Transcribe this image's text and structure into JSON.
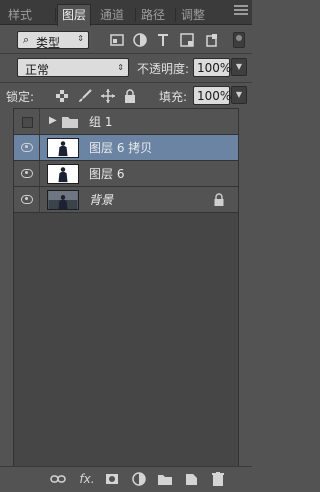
{
  "tabs": [
    {
      "label": "样式",
      "active": false
    },
    {
      "label": "图层",
      "active": true
    },
    {
      "label": "通道",
      "active": false
    },
    {
      "label": "路径",
      "active": false
    },
    {
      "label": "调整",
      "active": false
    }
  ],
  "filter": {
    "kind_label": "类型"
  },
  "blend": {
    "mode": "正常",
    "opacity_label": "不透明度:",
    "opacity_value": "100%"
  },
  "lock": {
    "label": "锁定:",
    "fill_label": "填充:",
    "fill_value": "100%"
  },
  "layers": [
    {
      "name": "组 1",
      "visible": false,
      "type": "group"
    },
    {
      "name": "图层 6 拷贝",
      "visible": true,
      "selected": true,
      "type": "layer"
    },
    {
      "name": "图层 6",
      "visible": true,
      "type": "layer"
    },
    {
      "name": "背景",
      "visible": true,
      "type": "background",
      "locked": true
    }
  ],
  "bottom_icons": [
    "link-icon",
    "fx-icon",
    "mask-icon",
    "adjustment-icon",
    "folder-icon",
    "new-layer-icon",
    "trash-icon"
  ],
  "bottom_fx_label": "fx.",
  "colors": {
    "panel": "#535353",
    "selected_row": "#6b84a3",
    "field": "#dcdcdc"
  }
}
